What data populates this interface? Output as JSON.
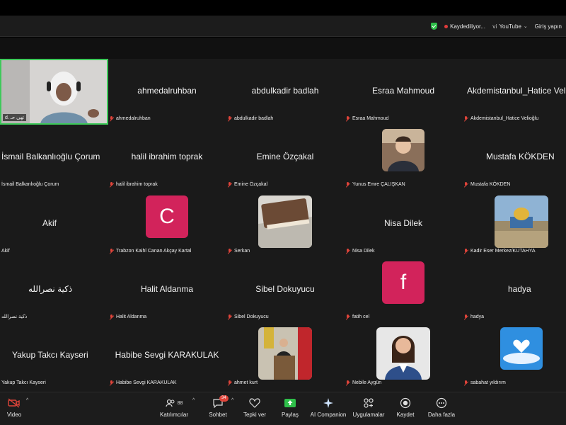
{
  "topbar": {
    "recording": "Kaydediliyor...",
    "youtube": "YouTube",
    "signin": "Giriş yapın"
  },
  "tiles": [
    {
      "name": "",
      "label": "d. تهى حـ",
      "kind": "video"
    },
    {
      "name": "ahmedalruhban",
      "label": "ahmedalruhban",
      "kind": "name"
    },
    {
      "name": "abdulkadir badlah",
      "label": "abdulkadir badlah",
      "kind": "name"
    },
    {
      "name": "Esraa Mahmoud",
      "label": "Esraa Mahmoud",
      "kind": "name"
    },
    {
      "name": "Akdemistanbul_Hatice Velioğlu",
      "label": "Akdemistanbul_Hatice Velioğlu",
      "kind": "name"
    },
    {
      "name": "İsmail Balkanlıoğlu Çorum",
      "label": "İsmail Balkanlıoğlu Çorum",
      "kind": "name"
    },
    {
      "name": "halil ibrahim toprak",
      "label": "halil ibrahim toprak",
      "kind": "name"
    },
    {
      "name": "Emine Özçakal",
      "label": "Emine Özçakal",
      "kind": "name"
    },
    {
      "name": "",
      "label": "Yunus Emre ÇALIŞKAN",
      "kind": "photo"
    },
    {
      "name": "Mustafa KÖKDEN",
      "label": "Mustafa KÖKDEN",
      "kind": "name"
    },
    {
      "name": "Akif",
      "label": "Akif",
      "kind": "name"
    },
    {
      "name": "",
      "label": "Trabzon Kaihl Canan Akçay Kartal",
      "kind": "avatar",
      "letter": "C"
    },
    {
      "name": "",
      "label": "Serkan",
      "kind": "book"
    },
    {
      "name": "Nisa Dilek",
      "label": "Nisa Dilek",
      "kind": "name"
    },
    {
      "name": "",
      "label": "Kadir Eser Merkez/KÜTAHYA",
      "kind": "mosque"
    },
    {
      "name": "ذكية نصرالله",
      "label": "ذكية نصرالله",
      "kind": "name"
    },
    {
      "name": "Halit Aldanma",
      "label": "Halit Aldanma",
      "kind": "name"
    },
    {
      "name": "Sibel Dokuyucu",
      "label": "Sibel Dokuyucu",
      "kind": "name"
    },
    {
      "name": "",
      "label": "fatih cel",
      "kind": "avatar",
      "letter": "f"
    },
    {
      "name": "hadya",
      "label": "hadya",
      "kind": "name"
    },
    {
      "name": "Yakup Takcı Kayseri",
      "label": "Yakup Takcı Kayseri",
      "kind": "name"
    },
    {
      "name": "Habibe Sevgi KARAKULAK",
      "label": "Habibe Sevgi KARAKULAK",
      "kind": "name"
    },
    {
      "name": "",
      "label": "ahmet kurt",
      "kind": "podium"
    },
    {
      "name": "",
      "label": "Nebile Aygün",
      "kind": "woman"
    },
    {
      "name": "",
      "label": "sabahat yıldırım",
      "kind": "heart"
    }
  ],
  "toolbar": {
    "video": "Video",
    "participants": "Katılımcılar",
    "participants_count": "88",
    "chat": "Sohbet",
    "chat_badge": "34",
    "react": "Tepki ver",
    "share": "Paylaş",
    "ai": "AI Companion",
    "apps": "Uygulamalar",
    "record": "Kaydet",
    "more": "Daha fazla"
  },
  "colors": {
    "avatar_c": "#d2235b",
    "active_speaker": "#3ec95a",
    "share_green": "#2fbf4a",
    "mic_muted": "#e0443a"
  }
}
